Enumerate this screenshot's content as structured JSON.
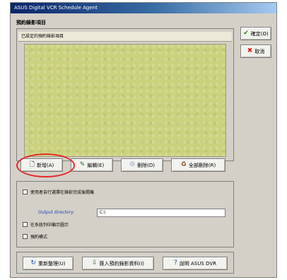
{
  "window": {
    "title": "ASUS Digital VCR Schedule Agent"
  },
  "schedule": {
    "section_title": "預約錄影項目",
    "list_header": "已設定的預約錄影項目"
  },
  "side_buttons": {
    "ok": "確定(O)",
    "cancel": "取消"
  },
  "list_buttons": {
    "add": "新增(A)",
    "edit": "編輯(E)",
    "delete": "刪除(D)",
    "delete_all": "全部刪除(R)"
  },
  "options": {
    "shutdown_label": "使用者自行選擇在錄影完成後關機",
    "output_label": "Output directory:",
    "output_value": "C:\\",
    "option2_label": "在系統列中顯示圖示",
    "option3_label": "預約模式"
  },
  "bottom_buttons": {
    "refresh": "重新整理(U)",
    "import": "匯入預約錄影資料(I)",
    "help": "說明 ASUS DVR"
  },
  "colors": {
    "highlight": "#e52a2a",
    "list_background": "#cbd27e"
  }
}
